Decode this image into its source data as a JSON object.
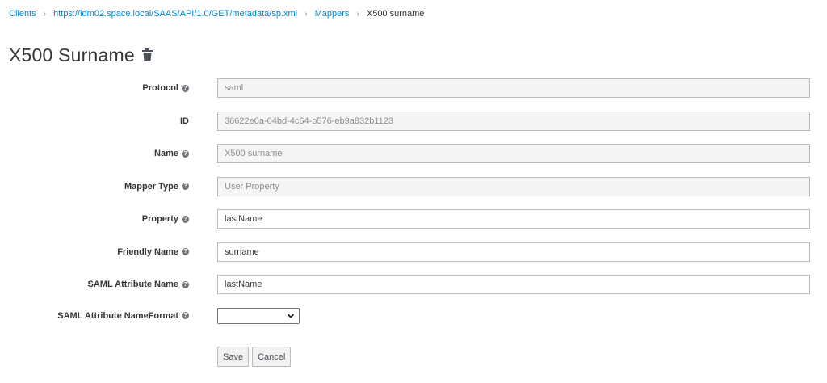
{
  "breadcrumb": {
    "items": [
      {
        "label": "Clients"
      },
      {
        "label": "https://idm02.space.local/SAAS/API/1.0/GET/metadata/sp.xml"
      },
      {
        "label": "Mappers"
      }
    ],
    "current": "X500 surname"
  },
  "header": {
    "title": "X500 Surname",
    "delete_icon": "trash-icon"
  },
  "form": {
    "protocol": {
      "label": "Protocol",
      "value": "saml",
      "readonly": true
    },
    "id": {
      "label": "ID",
      "value": "36622e0a-04bd-4c64-b576-eb9a832b1123",
      "readonly": true
    },
    "name": {
      "label": "Name",
      "value": "X500 surname",
      "readonly": true
    },
    "mapper_type": {
      "label": "Mapper Type",
      "value": "User Property",
      "readonly": true
    },
    "property": {
      "label": "Property",
      "value": "lastName"
    },
    "friendly_name": {
      "label": "Friendly Name",
      "value": "surname"
    },
    "saml_attribute_name": {
      "label": "SAML Attribute Name",
      "value": "lastName"
    },
    "saml_attribute_nameformat": {
      "label": "SAML Attribute NameFormat",
      "value": ""
    }
  },
  "actions": {
    "save_label": "Save",
    "cancel_label": "Cancel"
  },
  "colors": {
    "link": "#0088ce",
    "readonly_bg": "#f5f5f5",
    "border": "#bbbbbb"
  }
}
